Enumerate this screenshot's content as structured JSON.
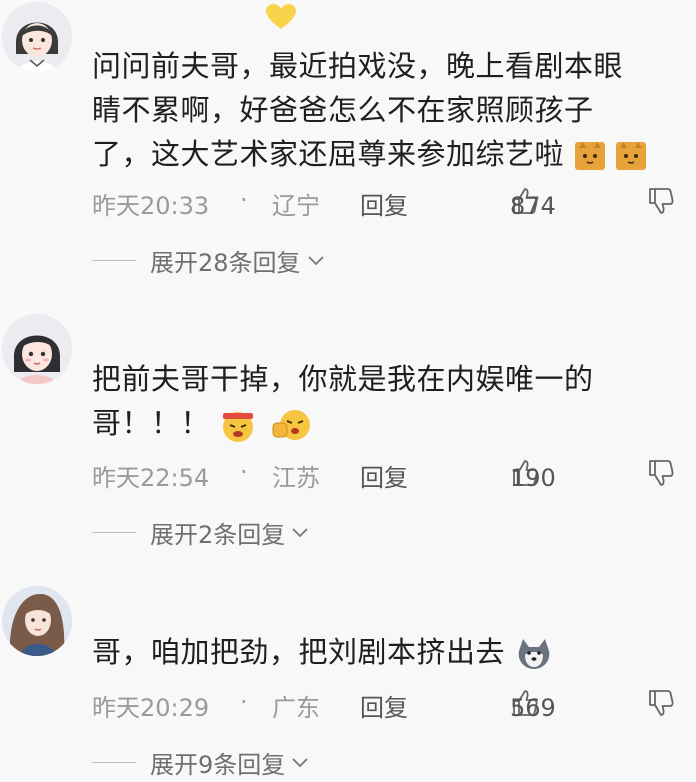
{
  "comments": [
    {
      "text_lines": [
        "问问前夫哥，最近拍戏没，晚上看剧本眼",
        "睛不累啊，好爸爸怎么不在家照顾孩子",
        "了，这大艺术家还屈尊来参加综艺啦"
      ],
      "time": "昨天20:33",
      "separator": "·",
      "location": "辽宁",
      "reply_label": "回复",
      "likes": "874",
      "expand_label": "展开28条回复"
    },
    {
      "text_lines": [
        "把前夫哥干掉，你就是我在内娱唯一的",
        "哥！！！"
      ],
      "time": "昨天22:54",
      "separator": "·",
      "location": "江苏",
      "reply_label": "回复",
      "likes": "190",
      "expand_label": "展开2条回复"
    },
    {
      "text_lines": [
        "哥，咱加把劲，把刘剧本挤出去"
      ],
      "time": "昨天20:29",
      "separator": "·",
      "location": "广东",
      "reply_label": "回复",
      "likes": "569",
      "expand_label": "展开9条回复"
    }
  ],
  "icons": {
    "heart": "yellow-heart-icon",
    "like": "thumbs-up-icon",
    "dislike": "thumbs-down-icon",
    "expand": "chevron-down-icon"
  },
  "colors": {
    "background": "#f8f8f8",
    "text": "#1f1f1f",
    "meta": "#9a9a9a",
    "heart": "#f7d44a"
  }
}
